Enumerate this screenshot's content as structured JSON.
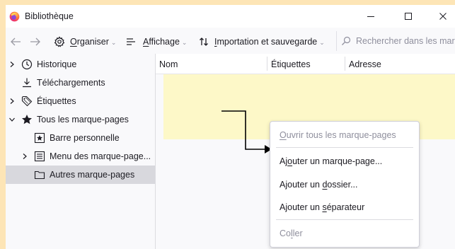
{
  "window": {
    "title": "Bibliothèque"
  },
  "toolbar": {
    "organize": {
      "pre": "",
      "key": "O",
      "post": "rganiser"
    },
    "view": {
      "pre": "",
      "key": "A",
      "post": "ffichage"
    },
    "import": {
      "pre": "",
      "key": "I",
      "post": "mportation et sauvegarde"
    },
    "search_placeholder": "Rechercher dans les marque-pages"
  },
  "sidebar": {
    "items": [
      {
        "label": "Historique"
      },
      {
        "label": "Téléchargements"
      },
      {
        "label": "Étiquettes"
      },
      {
        "label": "Tous les marque-pages"
      },
      {
        "label": "Barre personnelle"
      },
      {
        "label": "Menu des marque-page..."
      },
      {
        "label": "Autres marque-pages"
      }
    ]
  },
  "columns": [
    "Nom",
    "Étiquettes",
    "Adresse"
  ],
  "context_menu": {
    "open_all": {
      "pre": "",
      "key": "O",
      "post": "uvrir tous les marque-pages"
    },
    "add_bookmark": {
      "pre": "Aj",
      "key": "o",
      "post": "uter un marque-page..."
    },
    "add_folder": {
      "pre": "Ajouter un ",
      "key": "d",
      "post": "ossier..."
    },
    "add_separator": {
      "pre": "Ajouter un ",
      "key": "s",
      "post": "éparateur"
    },
    "paste": {
      "pre": "Co",
      "key": "l",
      "post": "ler"
    }
  },
  "colors": {
    "background": "#fde5b6",
    "highlight": "#fdf8c8",
    "selected_row": "#d8d8dd",
    "accent": "#ff7139"
  }
}
